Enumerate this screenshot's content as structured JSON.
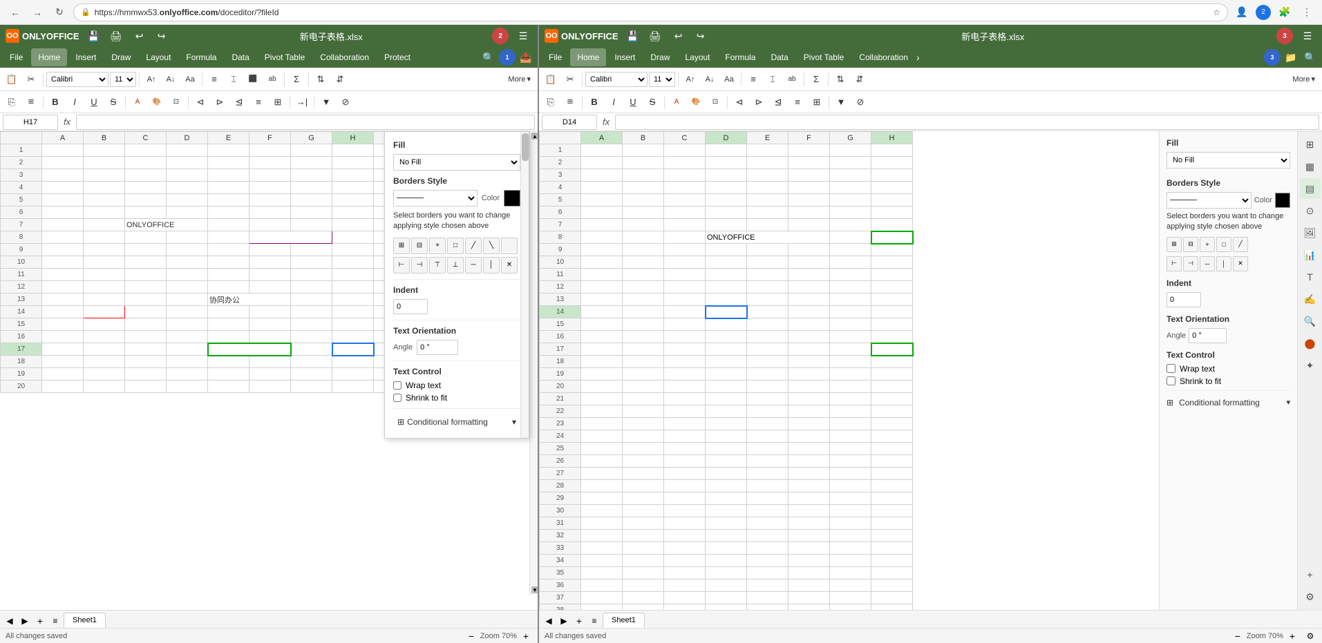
{
  "browser": {
    "url_prefix": "https://hmmwx53.",
    "url_bold": "onlyoffice.com",
    "url_suffix": "/doceditor/?fileId",
    "back_title": "Back",
    "forward_title": "Forward",
    "reload_title": "Reload"
  },
  "left_app": {
    "title_bar": {
      "logo_text": "OO",
      "app_name": "ONLYOFFICE",
      "filename": "新电子表格.xlsx",
      "save_icon": "💾",
      "print_icon": "🖨",
      "undo_icon": "↩",
      "redo_icon": "↪",
      "avatar_text": "2",
      "menu_icon": "☰"
    },
    "menu": {
      "items": [
        "File",
        "Home",
        "Insert",
        "Draw",
        "Layout",
        "Formula",
        "Data",
        "Pivot Table",
        "Collaboration",
        "Protect"
      ]
    },
    "toolbar": {
      "font_name": "Calibri",
      "font_size": "11",
      "more_label": "More"
    },
    "formula_bar": {
      "cell_ref": "H17",
      "fx_label": "fx"
    },
    "cell_reference_text": "H17",
    "formula_text": "",
    "sheet_tab": "Sheet1",
    "status": "All changes saved",
    "zoom_label": "Zoom 70%",
    "zoom_value": "70%",
    "spreadsheet": {
      "onlyoffice_cell": "ONLYOFFICE",
      "cowork_cell": "协同办公"
    }
  },
  "popup": {
    "fill_label": "Fill",
    "fill_value": "No Fill",
    "borders_label": "Borders Style",
    "color_label": "Color",
    "border_desc": "Select borders you want to change applying style chosen above",
    "indent_label": "Indent",
    "indent_value": "0",
    "text_orientation_label": "Text Orientation",
    "angle_label": "Angle",
    "angle_value": "0 °",
    "text_control_label": "Text Control",
    "wrap_text_label": "Wrap text",
    "shrink_to_label": "Shrink to fit",
    "conditional_label": "Conditional formatting",
    "border_icons": [
      "⊞",
      "⊟",
      "⊕",
      "◫",
      "╱",
      "╲",
      "▬",
      "│",
      "⊡",
      "⊟",
      "─",
      "─",
      "─",
      "─"
    ]
  },
  "right_app": {
    "title_bar": {
      "logo_text": "OO",
      "app_name": "ONLYOFFICE",
      "filename": "新电子表格.xlsx",
      "avatar_text": "3"
    },
    "menu": {
      "items": [
        "File",
        "Home",
        "Insert",
        "Draw",
        "Layout",
        "Formula",
        "Data",
        "Pivot Table",
        "Collaboration"
      ]
    },
    "toolbar": {
      "font_name": "Calibri",
      "font_size": "11",
      "more_label": "More"
    },
    "formula_bar": {
      "cell_ref": "D14",
      "fx_label": "fx"
    },
    "sheet_tab": "Sheet1",
    "status": "All changes saved",
    "zoom_label": "Zoom 70%",
    "zoom_value": "70%",
    "spreadsheet": {
      "onlyoffice_cell": "ONLYOFFICE"
    }
  },
  "right_format_panel": {
    "fill_label": "Fill",
    "fill_value": "No Fill",
    "borders_label": "Borders Style",
    "color_label": "Color",
    "border_desc": "Select borders you want to change applying style chosen above",
    "indent_label": "Indent",
    "indent_value": "0",
    "text_orientation_label": "Text Orientation",
    "angle_label": "Angle",
    "angle_value": "0 °",
    "text_control_label": "Text Control",
    "wrap_text_label": "Wrap text",
    "shrink_to_label": "Shrink to fit",
    "conditional_label": "Conditional formatting"
  },
  "icons": {
    "save": "💾",
    "print": "🖨",
    "undo": "↩",
    "redo": "↪",
    "copy": "⎘",
    "paste": "📋",
    "cut": "✂",
    "bold": "B",
    "italic": "I",
    "underline": "U",
    "strikethrough": "S",
    "search": "🔍",
    "filter": "▼",
    "sort": "⇅",
    "formula": "Σ",
    "comment": "💬",
    "image": "🖼",
    "chart": "📊",
    "settings": "⚙",
    "more": "⋯",
    "chevron_down": "▾",
    "chevron_right": "▸",
    "lock": "🔒",
    "zoom_in": "+",
    "zoom_out": "−",
    "add": "+",
    "close": "✕",
    "check": "✓",
    "grid": "⊞",
    "table": "▦",
    "text": "T",
    "paint": "🎨"
  }
}
